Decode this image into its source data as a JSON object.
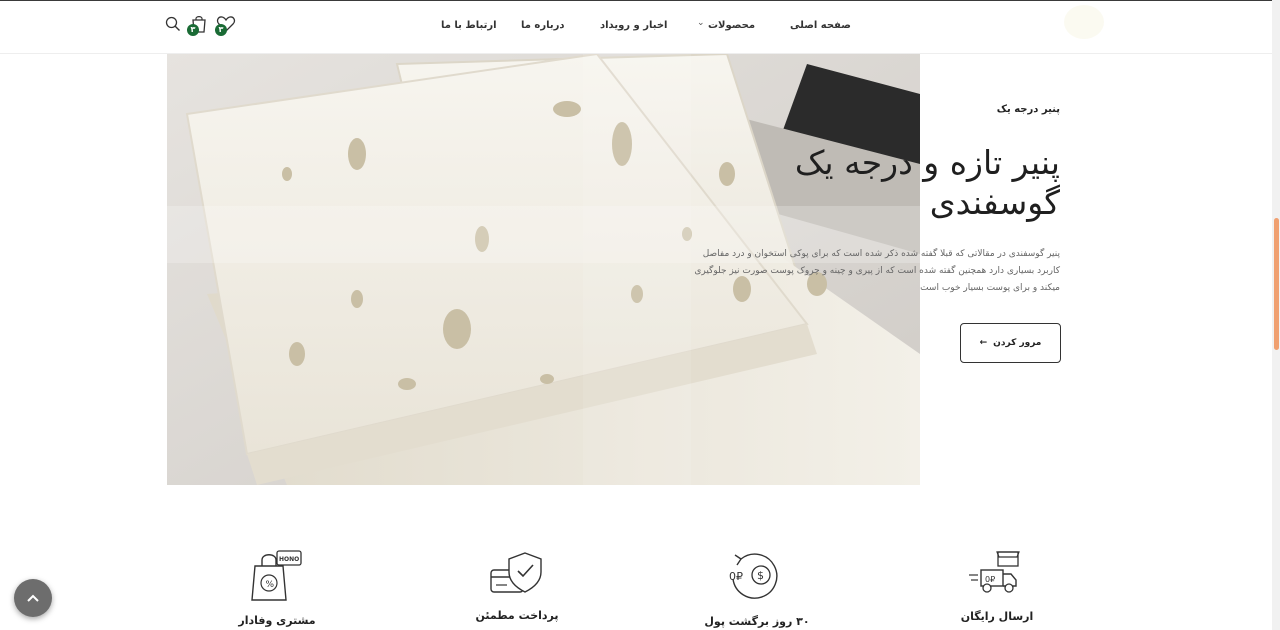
{
  "header": {
    "nav": [
      {
        "id": "home",
        "label": "صفحه اصلی"
      },
      {
        "id": "products",
        "label": "محصولات"
      },
      {
        "id": "news",
        "label": "اخبار و رویداد"
      },
      {
        "id": "about",
        "label": "درباره ما"
      },
      {
        "id": "contact",
        "label": "ارتباط با ما"
      }
    ],
    "wishlist_count": "۳",
    "cart_count": "۳",
    "icons": [
      "search-icon",
      "cart-icon",
      "heart-icon",
      "chevron-down-icon"
    ]
  },
  "hero": {
    "eyebrow": "پنیر درجه یک",
    "title": "پنیر تازه و درجه یک گوسفندی",
    "description": "پنیر گوسفندی در مقالاتی که قبلا گفته شده ذکر شده است که برای پوکی استخوان و درد مفاصل کاربرد بسیاری دارد همچنین گفته شده است که از پیری و چینه و چروک پوست صورت نیز جلوگیری میکند و برای پوست بسیار خوب است",
    "button_label": "مرور کردن",
    "button_arrow": "←"
  },
  "features": [
    {
      "id": "loyal",
      "label": "مشتری وفادار",
      "icon": "loyal-customer-icon"
    },
    {
      "id": "payment",
      "label": "پرداخت مطمئن",
      "icon": "secure-payment-icon"
    },
    {
      "id": "moneyback",
      "label": "۳۰ روز برگشت پول",
      "icon": "money-back-icon"
    },
    {
      "id": "shipping",
      "label": "ارسال رایگان",
      "icon": "free-shipping-icon"
    }
  ],
  "colors": {
    "badge": "#1a6b35",
    "scroll_thumb": "#f0a070",
    "to_top": "#6d6d6d"
  }
}
